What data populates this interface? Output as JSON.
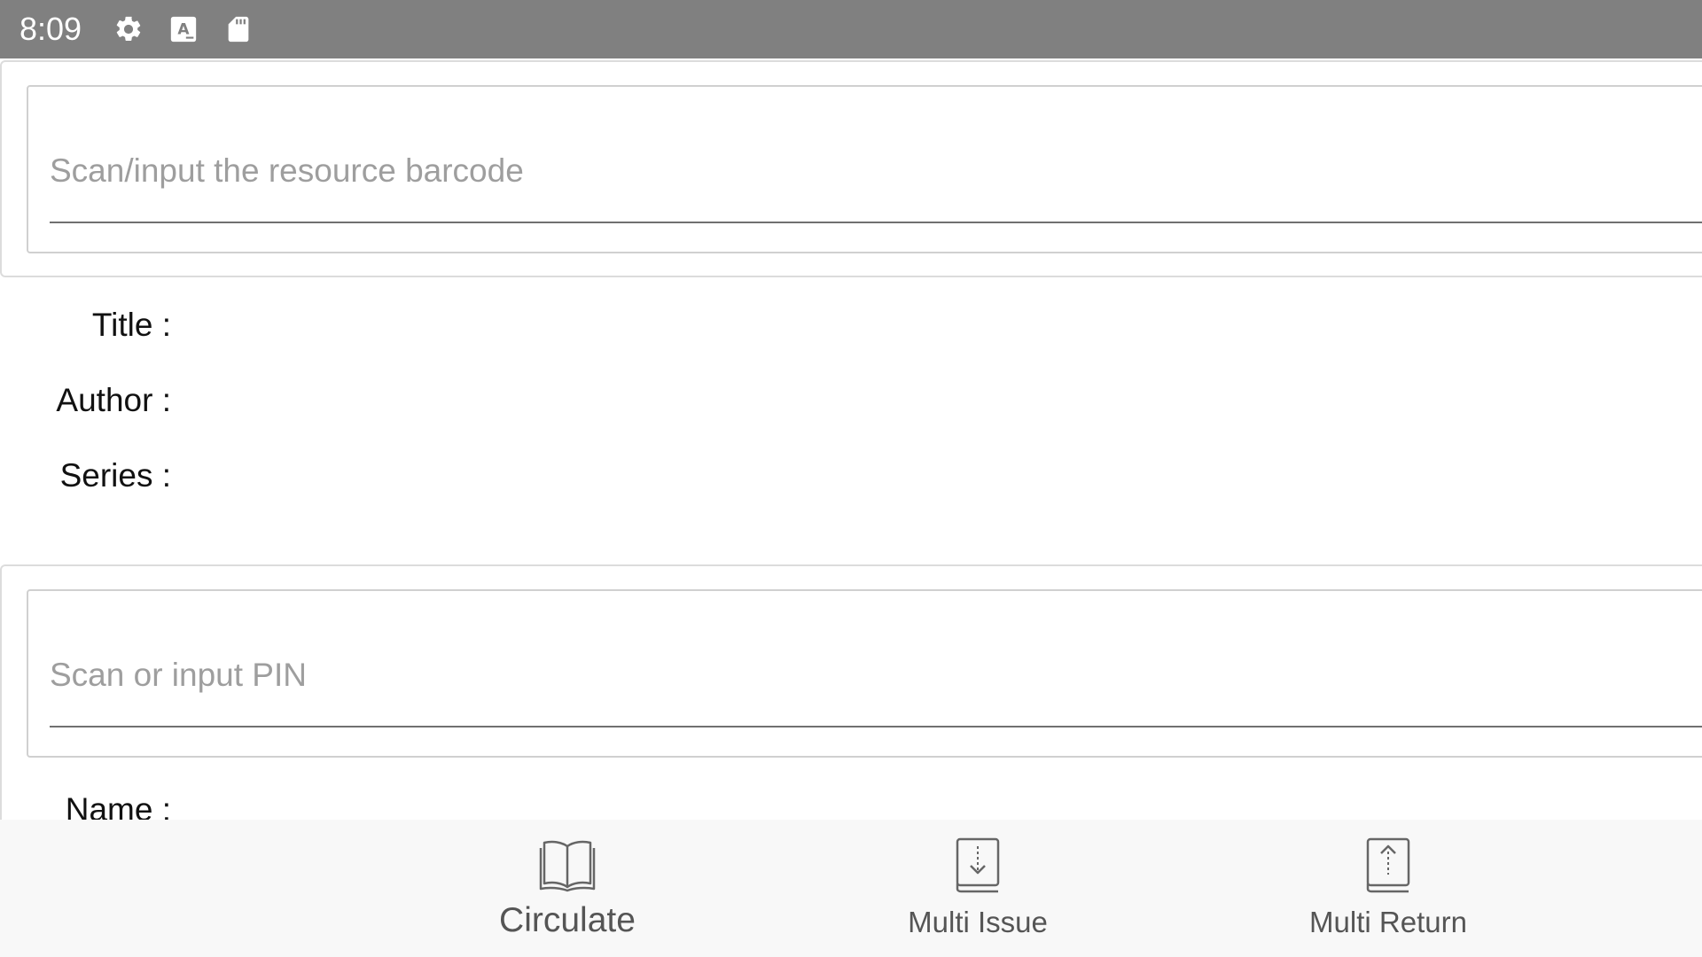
{
  "status_bar": {
    "time": "8:09",
    "icons": [
      "settings-icon",
      "keyboard-a-icon",
      "sd-card-icon"
    ]
  },
  "resource": {
    "barcode_placeholder": "Scan/input the resource barcode",
    "barcode_value": "",
    "labels": {
      "title": "Title :",
      "author": "Author :",
      "series": "Series :"
    }
  },
  "patron": {
    "pin_placeholder": "Scan or input PIN",
    "pin_value": "",
    "labels": {
      "name": "Name :"
    }
  },
  "bottom_nav": {
    "items": [
      {
        "label": "Circulate",
        "icon": "open-book-icon"
      },
      {
        "label": "Multi Issue",
        "icon": "book-download-icon"
      },
      {
        "label": "Multi Return",
        "icon": "book-upload-icon"
      }
    ]
  },
  "colors": {
    "status_bar_bg": "#808080",
    "placeholder": "#9e9e9e",
    "nav_text": "#555555",
    "nav_bg": "#f8f8f8"
  }
}
